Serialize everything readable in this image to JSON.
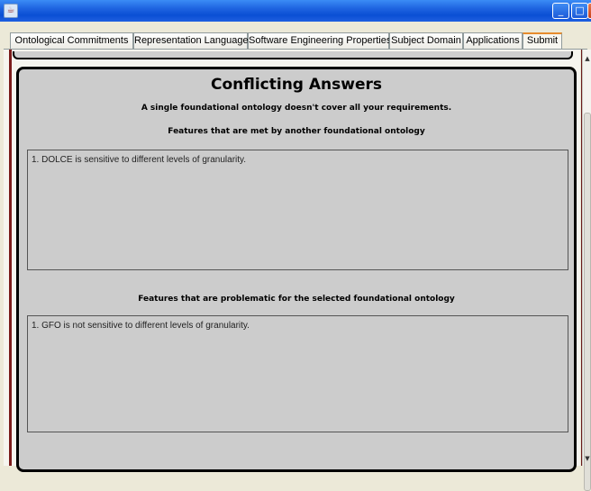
{
  "window": {
    "icons": {
      "app": "java-cup-icon",
      "minimize": "minimize-icon",
      "maximize": "maximize-icon",
      "close": "close-icon"
    }
  },
  "tabs": [
    {
      "label": "Ontological Commitments"
    },
    {
      "label": "Representation Language"
    },
    {
      "label": "Software Engineering Properties"
    },
    {
      "label": "Subject Domain"
    },
    {
      "label": "Applications"
    },
    {
      "label": "Submit",
      "selected": true
    }
  ],
  "content": {
    "title": "Conflicting Answers",
    "subtitle": "A single foundational ontology doesn't cover all your requirements.",
    "met_section": {
      "title": "Features that are met by another foundational ontology",
      "items": [
        "1. DOLCE is sensitive to different levels of granularity."
      ]
    },
    "problem_section": {
      "title": "Features that are problematic for the selected foundational ontology",
      "items": [
        "1. GFO is not sensitive to different levels of granularity."
      ]
    }
  },
  "colors": {
    "title_bar": "#0a4fd4",
    "selected_tab_accent": "#e68b2c",
    "panel_background": "#cccccc"
  }
}
